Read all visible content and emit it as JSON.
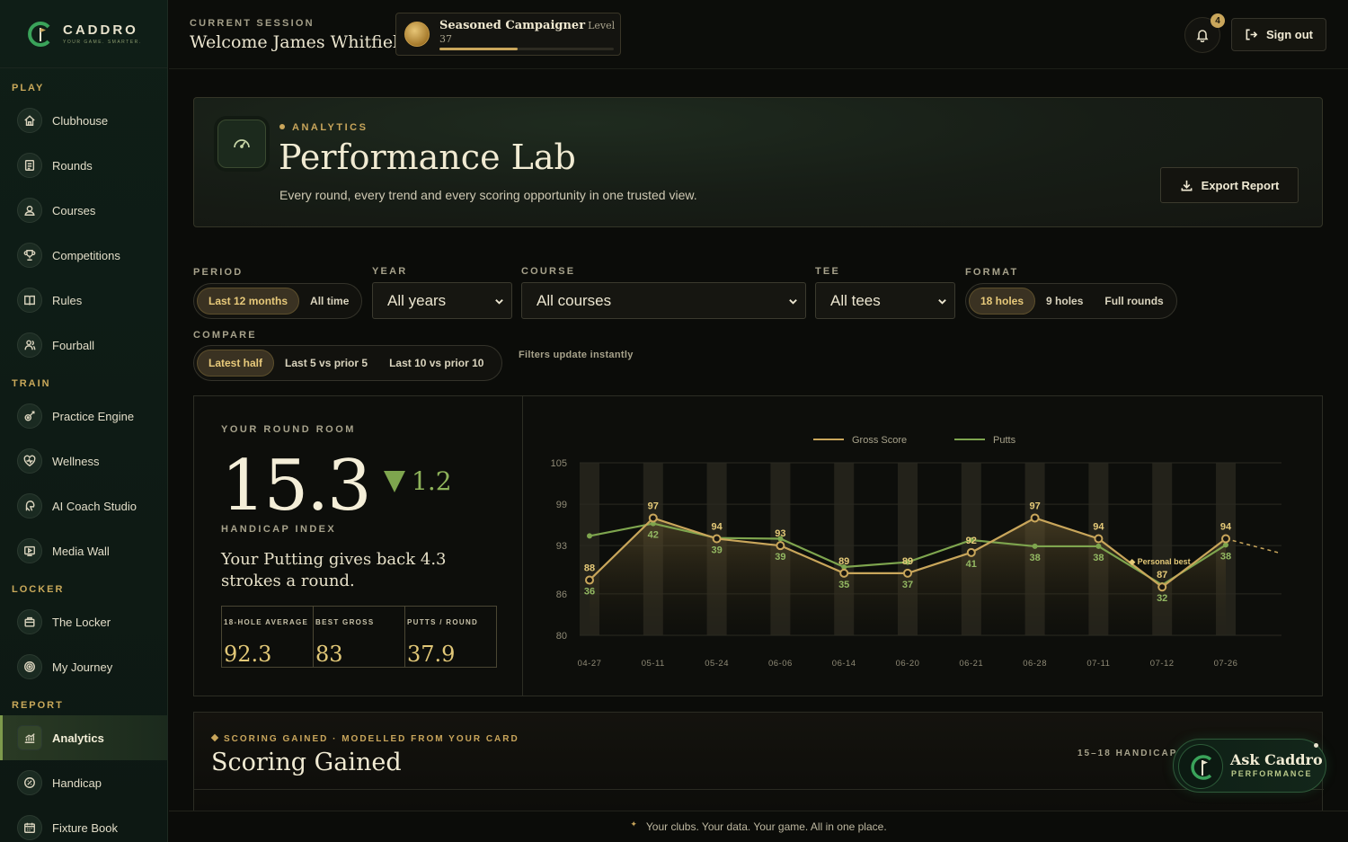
{
  "brand": {
    "name": "CADDRO",
    "tagline": "YOUR GAME. SMARTER."
  },
  "sidebar": {
    "sections": [
      {
        "title": "PLAY",
        "items": [
          {
            "label": "Clubhouse",
            "icon": "home-icon"
          },
          {
            "label": "Rounds",
            "icon": "scorecard-icon"
          },
          {
            "label": "Courses",
            "icon": "map-pin-icon"
          },
          {
            "label": "Competitions",
            "icon": "trophy-icon"
          },
          {
            "label": "Rules",
            "icon": "book-icon"
          },
          {
            "label": "Fourball",
            "icon": "group-icon"
          }
        ]
      },
      {
        "title": "TRAIN",
        "items": [
          {
            "label": "Practice Engine",
            "icon": "target-icon"
          },
          {
            "label": "Wellness",
            "icon": "heart-icon"
          },
          {
            "label": "AI Coach Studio",
            "icon": "ai-icon"
          },
          {
            "label": "Media Wall",
            "icon": "play-icon"
          }
        ]
      },
      {
        "title": "LOCKER",
        "items": [
          {
            "label": "The Locker",
            "icon": "bag-icon"
          },
          {
            "label": "My Journey",
            "icon": "compass-icon"
          }
        ]
      },
      {
        "title": "REPORT",
        "items": [
          {
            "label": "Analytics",
            "icon": "chart-icon",
            "active": true
          },
          {
            "label": "Handicap",
            "icon": "gauge-icon"
          },
          {
            "label": "Fixture Book",
            "icon": "calendar-icon"
          }
        ]
      }
    ]
  },
  "header": {
    "session_label": "CURRENT SESSION",
    "welcome": "Welcome James Whitfield",
    "level_title": "Seasoned Campaigner",
    "level_num": "Level 37",
    "level_progress": 0.45,
    "notifications": "4",
    "signout": "Sign out"
  },
  "hero": {
    "kicker": "ANALYTICS",
    "title": "Performance Lab",
    "subtitle": "Every round, every trend and every scoring opportunity in one trusted view.",
    "export": "Export Report"
  },
  "filters": {
    "period_label": "PERIOD",
    "period_options": [
      "Last 12 months",
      "All time"
    ],
    "year_label": "YEAR",
    "year_value": "All years",
    "course_label": "COURSE",
    "course_value": "All courses",
    "tee_label": "TEE",
    "tee_value": "All tees",
    "format_label": "FORMAT",
    "format_options": [
      "18 holes",
      "9 holes",
      "Full rounds"
    ],
    "compare_label": "COMPARE",
    "compare_options": [
      "Latest half",
      "Last 5 vs prior 5",
      "Last 10 vs prior 10"
    ],
    "note": "Filters update instantly"
  },
  "room": {
    "label": "YOUR ROUND ROOM",
    "handicap": "15.3",
    "delta": "1.2",
    "handicap_caption": "HANDICAP INDEX",
    "insight": "Your Putting gives back 4.3 strokes a round.",
    "stats": [
      {
        "label": "18-HOLE AVERAGE",
        "value": "92.3"
      },
      {
        "label": "BEST GROSS",
        "value": "83"
      },
      {
        "label": "PUTTS / ROUND",
        "value": "37.9"
      }
    ]
  },
  "chart_data": {
    "type": "line",
    "categories": [
      "04-27",
      "05-11",
      "05-24",
      "06-06",
      "06-14",
      "06-20",
      "06-21",
      "06-28",
      "07-11",
      "07-12",
      "07-26"
    ],
    "y_ticks": [
      105,
      99,
      93,
      86,
      80
    ],
    "ylim": [
      80,
      105
    ],
    "series": [
      {
        "name": "Gross Score",
        "color": "#c9a65b",
        "values": [
          88,
          97,
          94,
          93,
          89,
          89,
          92,
          97,
          94,
          87,
          94
        ],
        "labels": [
          "88",
          "97",
          "94",
          "93",
          "89",
          "89",
          "92",
          "97",
          "94",
          "87",
          "94"
        ]
      },
      {
        "name": "Putts",
        "color": "#7ea54e",
        "values": [
          94.4,
          96.2,
          94.1,
          94.0,
          89.9,
          90.6,
          93.8,
          92.9,
          92.9,
          87.3,
          93.1
        ],
        "labels": [
          "36",
          "42",
          "39",
          "39",
          "35",
          "37",
          "41",
          "38",
          "38",
          "32",
          "38"
        ]
      }
    ],
    "annotation": "Personal best",
    "projection": {
      "value": 92
    }
  },
  "scoring": {
    "kicker": "SCORING GAINED · MODELLED FROM YOUR CARD",
    "title": "Scoring Gained",
    "band": "15–18 HANDICAP ·"
  },
  "ask": {
    "title": "Ask Caddro",
    "sub": "PERFORMANCE"
  },
  "footer": {
    "text": "Your clubs. Your data. Your game. All in one place."
  }
}
